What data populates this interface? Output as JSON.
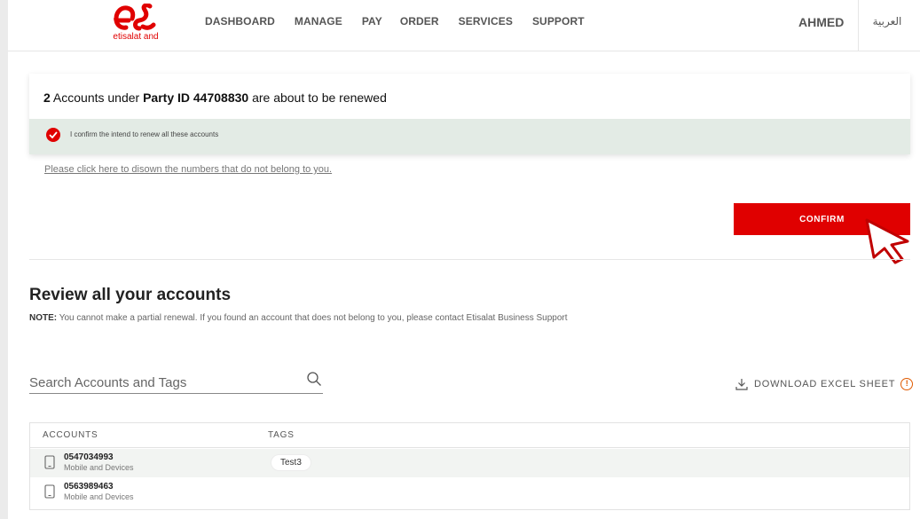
{
  "header": {
    "logo_text": "etisalat and",
    "nav": [
      "DASHBOARD",
      "MANAGE",
      "PAY",
      "ORDER",
      "SERVICES",
      "SUPPORT"
    ],
    "user": "AHMED",
    "language": "العربية",
    "brand_color": "#e00000"
  },
  "renewal": {
    "count": "2",
    "title_part1": " Accounts under ",
    "party_label": "Party ID 44708830",
    "title_part2": " are about to be renewed",
    "confirm_text": "I confirm the intend to renew all these accounts",
    "disown_link": "Please click here to disown the numbers that do not belong to you.",
    "confirm_button": "CONFIRM"
  },
  "review": {
    "title": "Review all your accounts",
    "note_label": "NOTE:",
    "note_text": " You cannot make a partial renewal. If you found an account that does not belong to you, please contact Etisalat Business Support",
    "search_placeholder": "Search Accounts and Tags",
    "download_label": "DOWNLOAD EXCEL SHEET",
    "info_glyph": "!"
  },
  "table": {
    "columns": [
      "ACCOUNTS",
      "TAGS"
    ],
    "rows": [
      {
        "number": "0547034993",
        "type": "Mobile and Devices",
        "tag": "Test3"
      },
      {
        "number": "0563989463",
        "type": "Mobile and Devices",
        "tag": ""
      }
    ]
  }
}
